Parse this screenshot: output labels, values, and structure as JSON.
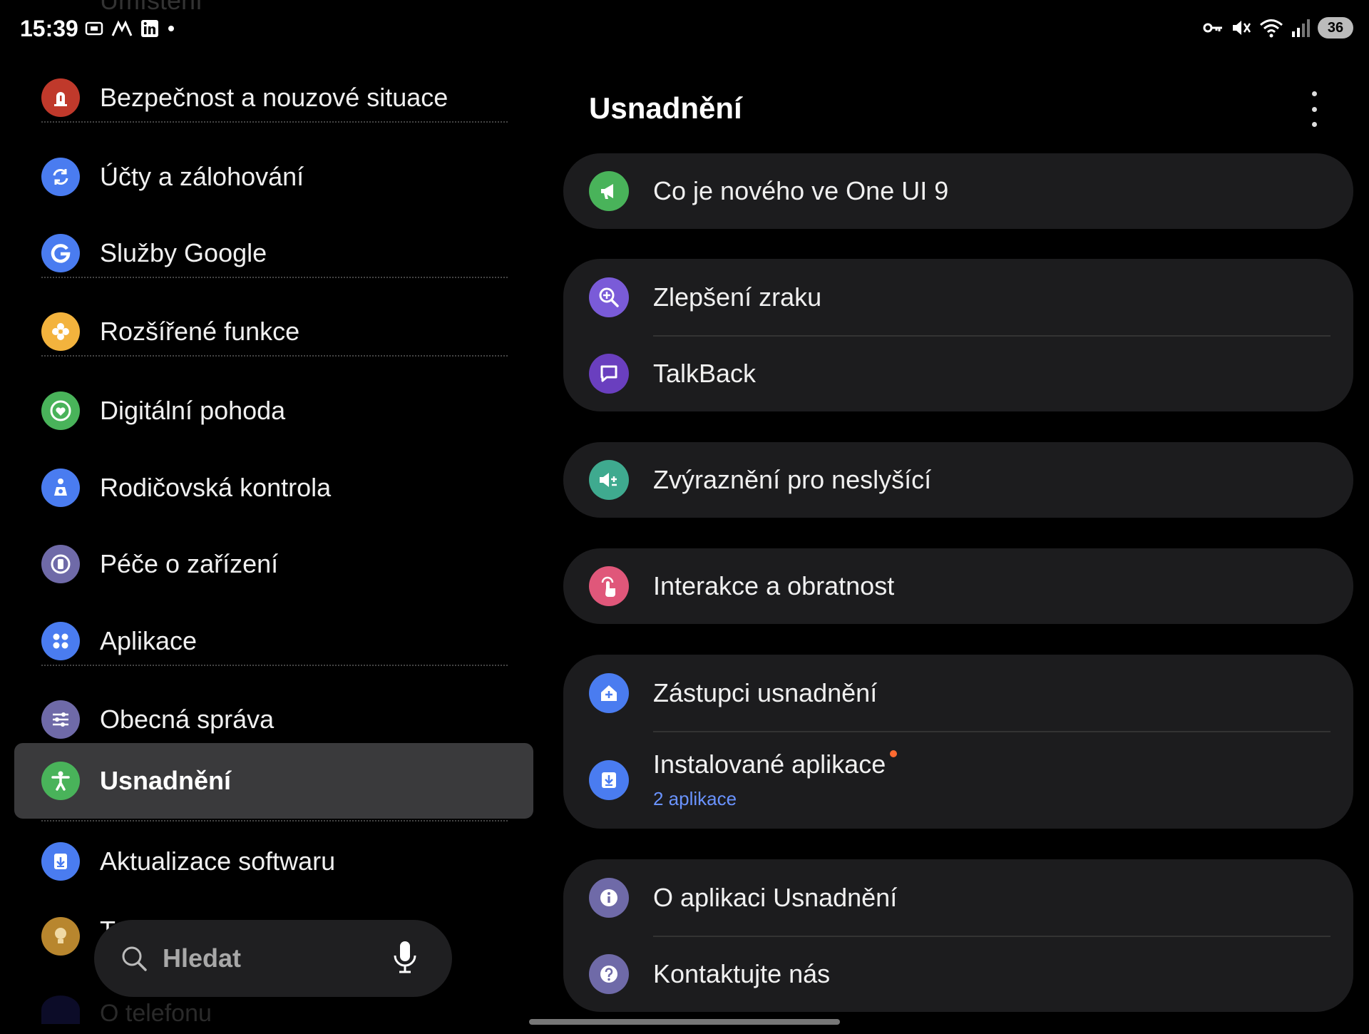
{
  "status": {
    "time": "15:39",
    "left_icons": [
      "screenshot-icon",
      "wave-icon",
      "linkedin-icon",
      "dot-icon"
    ],
    "right_icons": [
      "vpn-key-icon",
      "mute-icon",
      "wifi-icon",
      "signal-icon"
    ],
    "battery": "36"
  },
  "sidebar": {
    "ghost_top": "Umístění",
    "items": [
      {
        "label": "Bezpečnost a nouzové situace",
        "icon": "siren-icon",
        "color": "#c0392b"
      },
      {
        "label": "Účty a zálohování",
        "icon": "sync-icon",
        "color": "#4a7cf0"
      },
      {
        "label": "Služby Google",
        "icon": "google-icon",
        "color": "#4a7cf0"
      },
      {
        "label": "Rozšířené funkce",
        "icon": "puzzle-icon",
        "color": "#f3b33d"
      },
      {
        "label": "Digitální pohoda",
        "icon": "heart-icon",
        "color": "#49b35a"
      },
      {
        "label": "Rodičovská kontrola",
        "icon": "parent-icon",
        "color": "#4a7cf0"
      },
      {
        "label": "Péče o zařízení",
        "icon": "device-care-icon",
        "color": "#6f6aa8"
      },
      {
        "label": "Aplikace",
        "icon": "apps-icon",
        "color": "#4a7cf0"
      },
      {
        "label": "Obecná správa",
        "icon": "sliders-icon",
        "color": "#6f6aa8"
      },
      {
        "label": "Usnadnění",
        "icon": "accessibility-icon",
        "color": "#49b35a"
      },
      {
        "label": "Aktualizace softwaru",
        "icon": "update-icon",
        "color": "#4a7cf0"
      }
    ],
    "ghost_bottom": "O telefonu",
    "ghost_hidden_label": "T"
  },
  "search": {
    "label": "Hledat"
  },
  "main": {
    "title": "Usnadnění",
    "groups": [
      [
        {
          "label": "Co je nového ve One UI 9",
          "icon": "megaphone-icon",
          "color": "#49b35a"
        }
      ],
      [
        {
          "label": "Zlepšení zraku",
          "icon": "magnifier-icon",
          "color": "#7a5bd8"
        },
        {
          "label": "TalkBack",
          "icon": "chat-icon",
          "color": "#6a3fbf"
        }
      ],
      [
        {
          "label": "Zvýraznění pro neslyšící",
          "icon": "speaker-plus-icon",
          "color": "#3faa8f"
        }
      ],
      [
        {
          "label": "Interakce a obratnost",
          "icon": "touch-icon",
          "color": "#e0577a"
        }
      ],
      [
        {
          "label": "Zástupci usnadnění",
          "icon": "home-plus-icon",
          "color": "#4a7cf0"
        },
        {
          "label": "Instalované aplikace",
          "sub": "2 aplikace",
          "icon": "download-icon",
          "color": "#4a7cf0"
        }
      ],
      [
        {
          "label": "O aplikaci Usnadnění",
          "icon": "info-icon",
          "color": "#6f6aa8"
        },
        {
          "label": "Kontaktujte nás",
          "icon": "help-icon",
          "color": "#6f6aa8"
        }
      ]
    ]
  }
}
